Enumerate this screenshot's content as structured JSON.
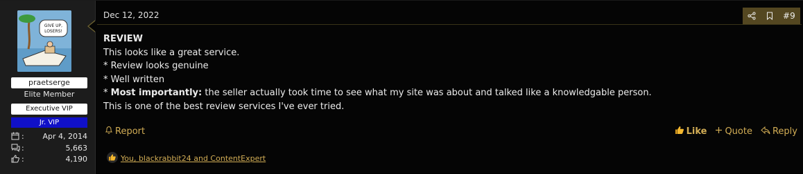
{
  "user": {
    "username": "praetserge",
    "title": "Elite Member",
    "banners": [
      "Executive VIP",
      "Jr. VIP"
    ],
    "avatar_caption": "GIVE UP, LOSERS!",
    "stats": [
      {
        "icon": "calendar-icon",
        "value": "Apr 4, 2014"
      },
      {
        "icon": "messages-icon",
        "value": "5,663"
      },
      {
        "icon": "thumbs-up-icon",
        "value": "4,190"
      }
    ],
    "stat_colon": ":"
  },
  "post": {
    "date": "Dec 12, 2022",
    "number": "#9",
    "lines": {
      "heading": "REVIEW",
      "l1": "This looks like a great service.",
      "l2": "* Review looks genuine",
      "l3": "* Well written",
      "l4_prefix": "* ",
      "l4_bold": "Most importantly:",
      "l4_rest": " the seller actually took time to see what my site was about and talked like a knowledgable person.",
      "l5": "This is one of the best review services I've ever tried."
    }
  },
  "actions": {
    "report": "Report",
    "like": "Like",
    "quote": "Quote",
    "reply": "Reply"
  },
  "reactions": {
    "text": "You, blackrabbit24 and ContentExpert"
  },
  "colors": {
    "accent": "#d2ad55",
    "header_bar": "#544721",
    "jr_vip": "#1010c8"
  }
}
